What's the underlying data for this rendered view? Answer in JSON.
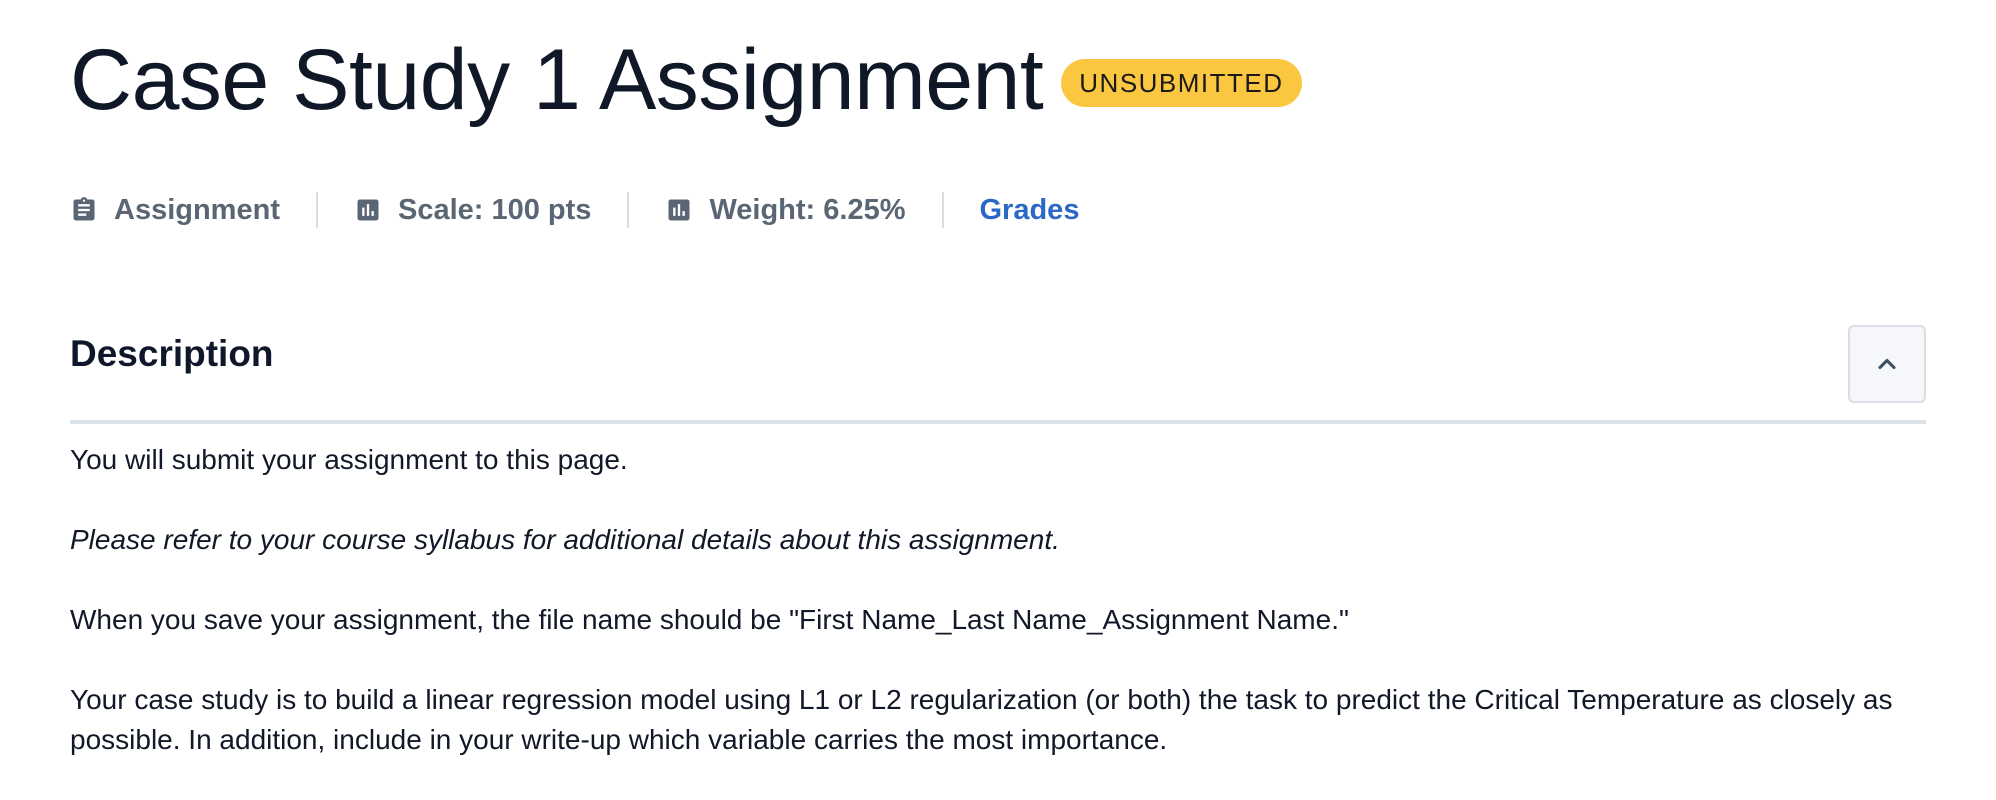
{
  "header": {
    "title": "Case Study 1 Assignment",
    "status_badge": "UNSUBMITTED",
    "badge_color": "#fbc640"
  },
  "meta": {
    "type": {
      "icon": "clipboard-icon",
      "label": "Assignment"
    },
    "scale": {
      "icon": "bar-chart-icon",
      "label": "Scale: 100 pts"
    },
    "weight": {
      "icon": "bar-chart-icon",
      "label": "Weight: 6.25%"
    },
    "grades_link": "Grades",
    "link_color": "#2b68c6"
  },
  "description": {
    "heading": "Description",
    "collapse_icon": "chevron-up-icon",
    "paragraphs": [
      "You will submit your assignment to this page.",
      "Please refer to your course syllabus for additional details about this assignment.",
      "When you save your assignment, the file name should be \"First Name_Last Name_Assignment Name.\"",
      "Your case study is to build a linear regression model using L1 or L2 regularization (or both) the task to predict the Critical Temperature as closely as possible. In addition, include in your write-up which variable carries the most importance."
    ]
  }
}
